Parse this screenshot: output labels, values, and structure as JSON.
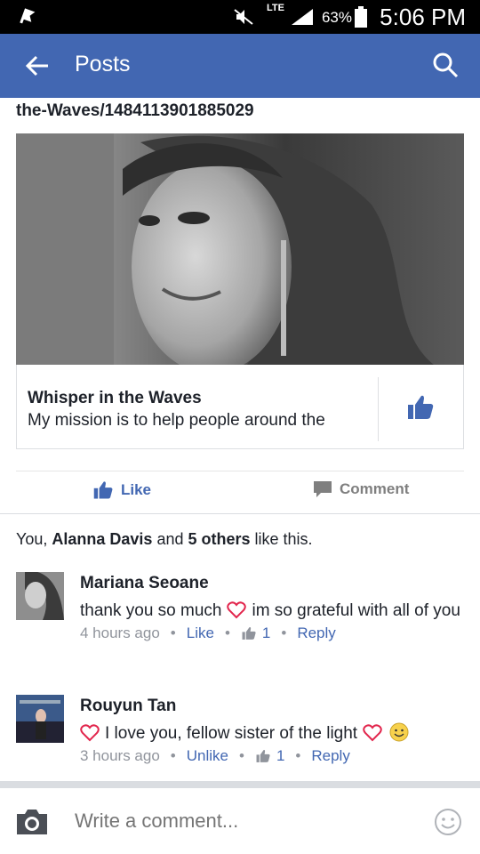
{
  "status_bar": {
    "network": "LTE",
    "battery": "63%",
    "time": "5:06 PM"
  },
  "app_bar": {
    "title": "Posts"
  },
  "post": {
    "link_url": "the-Waves/1484113901885029",
    "card": {
      "page_name": "Whisper in the Waves",
      "description": "My mission is to help people around the"
    },
    "actions": {
      "like": "Like",
      "comment": "Comment"
    },
    "likes": {
      "prefix": "You, ",
      "name": "Alanna Davis",
      "mid": " and ",
      "others": "5 others",
      "suffix": " like this."
    }
  },
  "comments": [
    {
      "author": "Mariana Seoane",
      "text_before": "thank you so much",
      "text_after": "im so grateful with all of you",
      "time": "4 hours ago",
      "like_label": "Like",
      "like_count": "1",
      "reply_label": "Reply"
    },
    {
      "author": "Rouyun Tan",
      "text": "I love you, fellow sister of the light",
      "time": "3 hours ago",
      "like_label": "Unlike",
      "like_count": "1",
      "reply_label": "Reply"
    }
  ],
  "composer": {
    "placeholder": "Write a comment..."
  },
  "colors": {
    "brand": "#4267b2",
    "heart": "#e2264d",
    "meta": "#90949c"
  }
}
